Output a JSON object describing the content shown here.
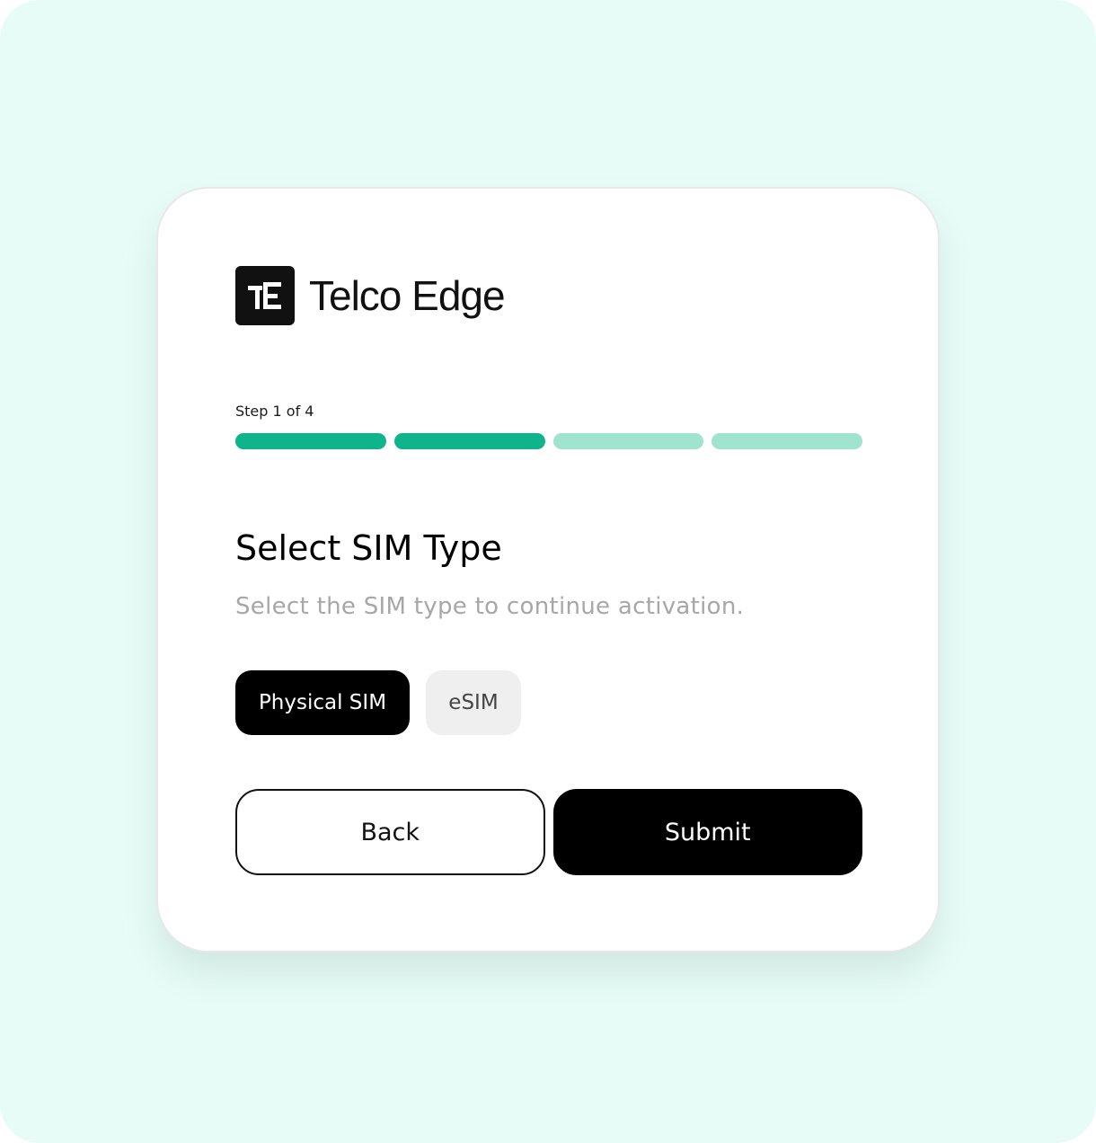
{
  "brand": {
    "name": "Telco Edge",
    "icon": "telco-edge-logo-icon"
  },
  "progress": {
    "label": "Step 1 of 4",
    "segments": [
      {
        "state": "complete"
      },
      {
        "state": "complete"
      },
      {
        "state": "pending"
      },
      {
        "state": "pending"
      }
    ],
    "complete_color": "#10b48a",
    "pending_color": "#a0e3cf"
  },
  "form": {
    "title": "Select SIM Type",
    "subtitle": "Select the SIM type to continue activation.",
    "options": [
      {
        "label": "Physical SIM",
        "selected": true
      },
      {
        "label": "eSIM",
        "selected": false
      }
    ]
  },
  "actions": {
    "back_label": "Back",
    "submit_label": "Submit"
  },
  "colors": {
    "background": "#e8fcf7",
    "card": "#ffffff",
    "primary": "#000000"
  }
}
